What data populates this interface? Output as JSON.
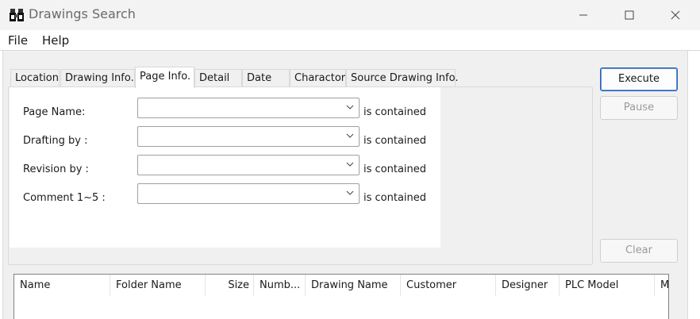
{
  "window": {
    "title": "Drawings Search",
    "icons": {
      "app": "binoculars-app-icon",
      "minimize": "minimize-icon",
      "maximize": "maximize-icon",
      "close": "close-icon"
    }
  },
  "menu": {
    "items": [
      "File",
      "Help"
    ]
  },
  "tabs": [
    {
      "label": "Location",
      "active": false
    },
    {
      "label": "Drawing Info.",
      "active": false
    },
    {
      "label": "Page Info.",
      "active": true
    },
    {
      "label": "Detail",
      "active": false
    },
    {
      "label": "Date",
      "active": false
    },
    {
      "label": "Charactor",
      "active": false
    },
    {
      "label": "Source Drawing Info.",
      "active": false
    }
  ],
  "page_info": {
    "fields": [
      {
        "label": "Page Name:",
        "value": "",
        "condition": "is contained"
      },
      {
        "label": "Drafting by :",
        "value": "",
        "condition": "is contained"
      },
      {
        "label": "Revision by :",
        "value": "",
        "condition": "is contained"
      },
      {
        "label": "Comment 1~5 :",
        "value": "",
        "condition": "is contained"
      }
    ]
  },
  "buttons": {
    "execute": "Execute",
    "pause": "Pause",
    "clear": "Clear"
  },
  "results": {
    "columns": [
      "Name",
      "Folder Name",
      "Size",
      "Numb...",
      "Drawing Name",
      "Customer",
      "Designer",
      "PLC Model",
      "M"
    ]
  },
  "colors": {
    "accent": "#2a64b8",
    "disabled_text": "#9a9a9a",
    "background": "#f0f0f0"
  }
}
